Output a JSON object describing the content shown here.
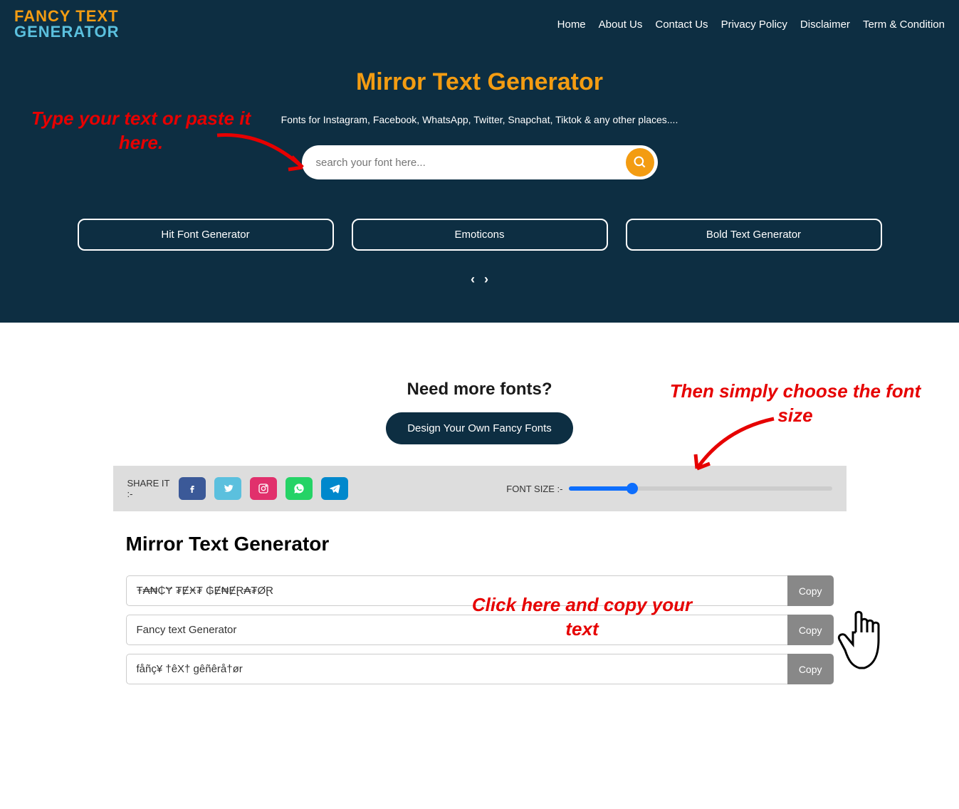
{
  "logo": {
    "line1": "FANCY TEXT",
    "line2": "GENERATOR"
  },
  "nav": {
    "items": [
      {
        "label": "Home"
      },
      {
        "label": "About Us"
      },
      {
        "label": "Contact Us"
      },
      {
        "label": "Privacy Policy"
      },
      {
        "label": "Disclaimer"
      },
      {
        "label": "Term & Condition"
      }
    ]
  },
  "hero": {
    "title": "Mirror Text Generator",
    "subtitle": "Fonts for Instagram, Facebook, WhatsApp, Twitter, Snapchat, Tiktok & any other places....",
    "search_placeholder": "search your font here..."
  },
  "pills": [
    {
      "label": "Hit Font Generator"
    },
    {
      "label": "Emoticons"
    },
    {
      "label": "Bold Text Generator"
    }
  ],
  "annotations": {
    "type_here": "Type your text or paste it here.",
    "choose_size": "Then simply choose the font size",
    "click_copy": "Click here and copy your text"
  },
  "need_more": "Need more fonts?",
  "design_button": "Design Your Own Fancy Fonts",
  "share": {
    "label": "SHARE IT :-",
    "font_size_label": "FONT SIZE :-"
  },
  "results": {
    "title": "Mirror Text Generator",
    "copy_label": "Copy",
    "rows": [
      {
        "text": "Ŧ₳₦₵Ɏ ₮ɆӾ₮ ₲Ɇ₦ɆⱤ₳₮ØⱤ"
      },
      {
        "text": "Fancy text Generator"
      },
      {
        "text": "fåñç¥ †êX† gêñêrå†ør"
      }
    ]
  }
}
